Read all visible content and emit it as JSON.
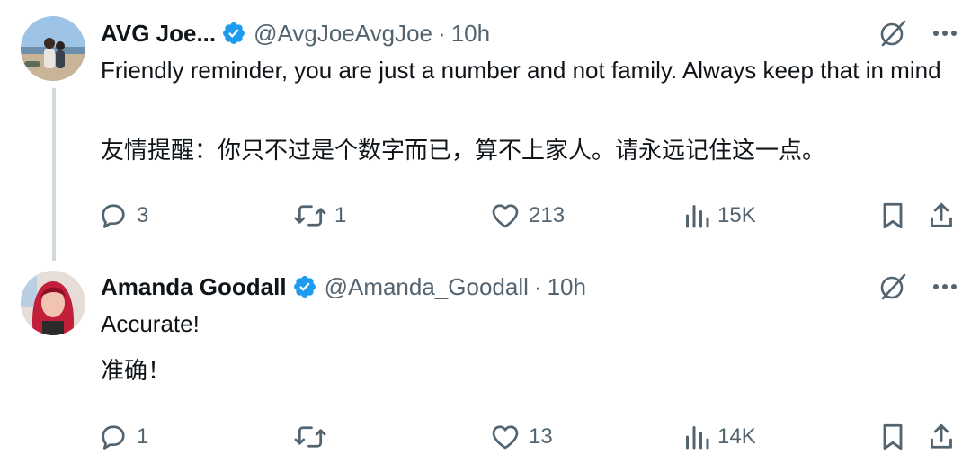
{
  "tweets": [
    {
      "display_name": "AVG Joe...",
      "handle": "@AvgJoeAvgJoe",
      "separator": "·",
      "time": "10h",
      "text": "Friendly reminder, you are just a number and not family. Always keep that in mind",
      "translation": "友情提醒：你只不过是个数字而已，算不上家人。请永远记住这一点。",
      "counts": {
        "replies": "3",
        "reposts": "1",
        "likes": "213",
        "views": "15K"
      }
    },
    {
      "display_name": "Amanda Goodall",
      "handle": "@Amanda_Goodall",
      "separator": "·",
      "time": "10h",
      "text": "Accurate!",
      "translation": "准确！",
      "counts": {
        "replies": "1",
        "reposts": "",
        "likes": "13",
        "views": "14K"
      }
    }
  ],
  "icons": {
    "verified": "verified-badge-icon",
    "grok": "grok-slash-icon",
    "more": "more-dots-icon",
    "reply": "reply-icon",
    "repost": "repost-icon",
    "like": "heart-icon",
    "views": "views-bar-icon",
    "bookmark": "bookmark-icon",
    "share": "share-icon"
  },
  "colors": {
    "text": "#0f1419",
    "muted": "#536471",
    "verified": "#1d9bf0",
    "thread_line": "#cfd9de"
  }
}
